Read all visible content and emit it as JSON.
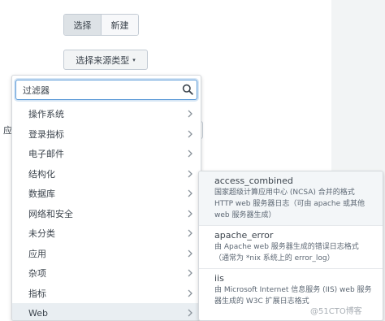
{
  "toolbar": {
    "select_label": "选择",
    "new_label": "新建"
  },
  "source_type_button": {
    "label": "选择来源类型",
    "caret": "▾"
  },
  "side_label": "应",
  "filter": {
    "placeholder": "过滤器",
    "icon": "search-icon"
  },
  "categories": [
    {
      "label": "操作系统"
    },
    {
      "label": "登录指标"
    },
    {
      "label": "电子邮件"
    },
    {
      "label": "结构化"
    },
    {
      "label": "数据库"
    },
    {
      "label": "网络和安全"
    },
    {
      "label": "未分类"
    },
    {
      "label": "应用"
    },
    {
      "label": "杂项"
    },
    {
      "label": "指标"
    },
    {
      "label": "Web"
    }
  ],
  "active_category": "Web",
  "flyout": {
    "items": [
      {
        "name": "access_combined",
        "desc_lines": [
          "国家超级计算应用中心 (NCSA) 合并的格式",
          "HTTP web 服务器日志（可由 apache 或其他",
          "web 服务器生成）"
        ]
      },
      {
        "name": "apache_error",
        "desc_lines": [
          "由 Apache web 服务器生成的错误日志格式",
          "（通常为 *nix 系统上的 error_log）"
        ]
      },
      {
        "name": "iis",
        "desc_lines": [
          "由 Microsoft Internet 信息服务 (IIS) web 服务",
          "器生成的 W3C 扩展日志格式"
        ]
      }
    ]
  },
  "watermark": "@51CTO博客",
  "colors": {
    "focus_border": "#5d9bd8",
    "active_row": "#e9eef2"
  }
}
